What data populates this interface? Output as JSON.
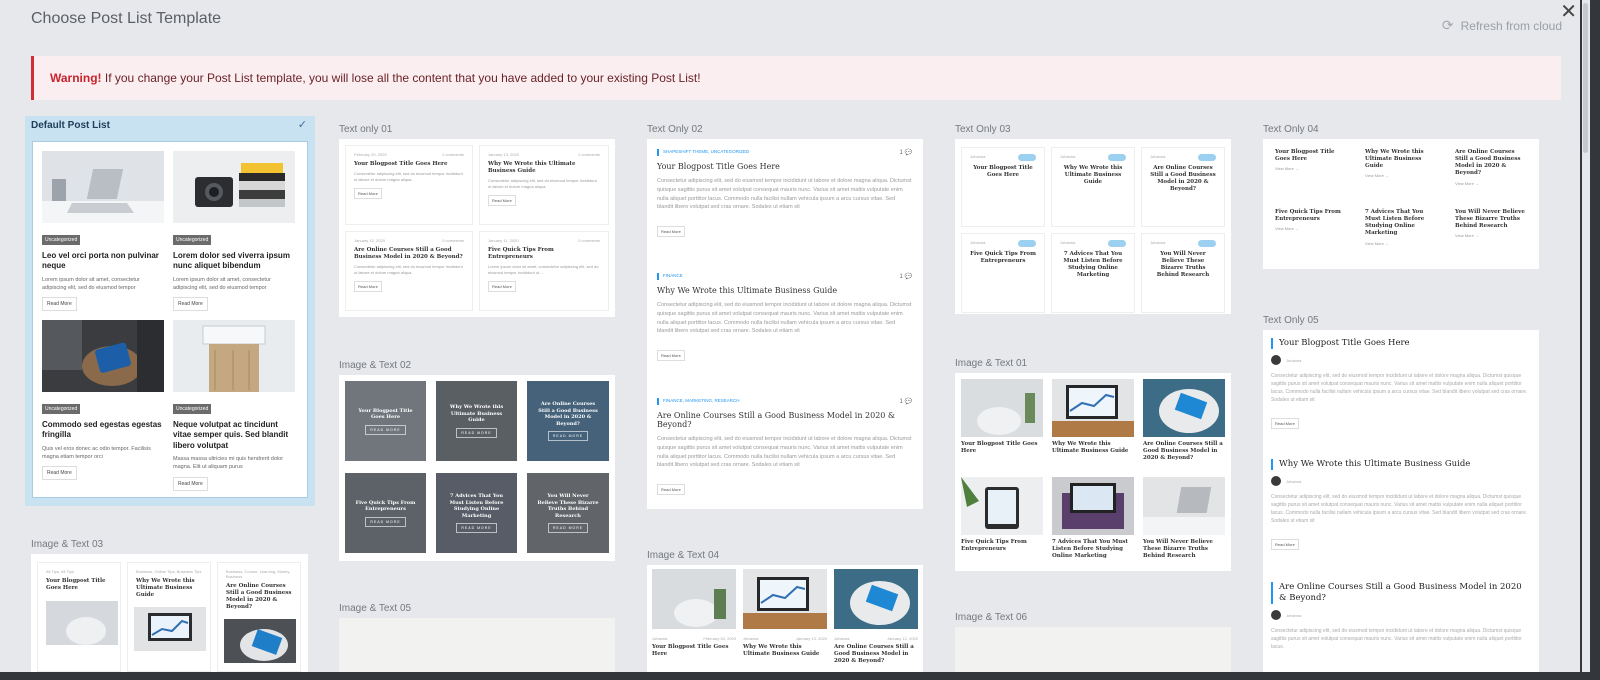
{
  "modal": {
    "title": "Choose Post List Template",
    "refresh_label": "Refresh from cloud",
    "close_glyph": "✕"
  },
  "warning": {
    "strong": "Warning!",
    "text": " If you change your Post List template, you will lose all the content that you have added to your existing Post List!"
  },
  "colors": {
    "warning_bg": "#fbeef0",
    "warning_accent": "#d12d36",
    "selected_bg": "#c8e2f2",
    "accent_blue": "#2196f3"
  },
  "templates": {
    "default": {
      "label": "Default Post List",
      "selected": true,
      "check": "✓",
      "posts": [
        {
          "badge": "Uncategorized",
          "title": "Leo vel orci porta non pulvinar neque",
          "text": "Lorem ipsum dolor sit amet, consectetur adipiscing elit, sed do eiusmod tempor",
          "more": "Read More"
        },
        {
          "badge": "Uncategorized",
          "title": "Lorem dolor sed viverra ipsum nunc aliquet bibendum",
          "text": "Lorem ipsum dolor sit amet, consectetur adipiscing elit, sed do eiusmod tempor",
          "more": "Read More"
        },
        {
          "badge": "Uncategorized",
          "title": "Commodo sed egestas egestas fringilla",
          "text": "Quis vel eros donec ac odio tempor. Facilisis magna etiam tempor orci",
          "more": "Read More"
        },
        {
          "badge": "Uncategorized",
          "title": "Neque volutpat ac tincidunt vitae semper quis. Sed blandit libero volutpat",
          "text": "Massa massa ultricies mi quis hendrerit dolor magna. Elit ut aliquam purus",
          "more": "Read More"
        }
      ]
    },
    "image_text_03": {
      "label": "Image & Text 03",
      "posts": [
        {
          "meta": "All Tips, All Tips",
          "title": "Your Blogpost Title Goes Here"
        },
        {
          "meta": "Business, Online Tips, Business Tips",
          "title": "Why We Wrote this Ultimate Business Guide"
        },
        {
          "meta": "Business, Course, Learning, Money, Business",
          "title": "Are Online Courses Still a Good Business Model in 2020 & Beyond?"
        }
      ]
    },
    "text_only_01": {
      "label": "Text only 01",
      "posts": [
        {
          "date": "February 20, 2020",
          "comments": "2 comments",
          "title": "Your Blogpost Title Goes Here",
          "text": "Consectetur adipiscing elit, sed do eiusmod tempor incididunt ut labore et dolore magna aliqua.",
          "more": "Read More"
        },
        {
          "date": "January 13, 2020",
          "comments": "2 comments",
          "title": "Why We Wrote this Ultimate Business Guide",
          "text": "Consectetur adipiscing elit, sed do eiusmod tempor incididunt ut labore et dolore magna aliqua.",
          "more": "Read More"
        },
        {
          "date": "January 12, 2020",
          "comments": "0 comments",
          "title": "Are Online Courses Still a Good Business Model in 2020 & Beyond?",
          "text": "Consectetur adipiscing elit, sed do eiusmod tempor incididunt ut labore et dolore magna aliqua.",
          "more": "Read More"
        },
        {
          "date": "January 11, 2020",
          "comments": "0 comments",
          "title": "Five Quick Tips From Entrepreneurs",
          "text": "Lorem ipsum dolor sit amet, consectetur adipiscing elit, sed do eiusmod tempor incididunt ut ...",
          "more": "Read More"
        }
      ]
    },
    "image_text_02": {
      "label": "Image & Text 02",
      "tiles": [
        {
          "title": "Your Blogpost Title Goes Here",
          "more": "READ MORE"
        },
        {
          "title": "Why We Wrote this Ultimate Business Guide",
          "more": "READ MORE"
        },
        {
          "title": "Are Online Courses Still a Good Business Model in 2020 & Beyond?",
          "more": "READ MORE"
        },
        {
          "title": "Five Quick Tips From Entrepreneurs",
          "more": "READ MORE"
        },
        {
          "title": "7 Advices That You Must Listen Before Studying Online Marketing",
          "more": "READ MORE"
        },
        {
          "title": "You Will Never Believe These Bizarre Truths Behind Research",
          "more": "READ MORE"
        }
      ]
    },
    "image_text_05": {
      "label": "Image & Text 05"
    },
    "text_only_02": {
      "label": "Text Only 02",
      "posts": [
        {
          "cat": "SHAPESHIFT THEME, UNCATEGORIZED",
          "count": "1",
          "title": "Your Blogpost Title Goes Here",
          "text": "Consectetur adipiscing elit, sed do eiusmod tempor incididunt ut labore et dolore magna aliqua. Dictumst quisque sagittis purus sit amet volutpat consequat mauris nunc. Varius sit amet mattis vulputate enim nulla aliquet porttitor lacus. Commodo nulla facilisi nullam vehicula ipsum a arcu cursus vitae. Sed blandit libero volutpat sed cras ornare. Sodales ut etiam sit",
          "more": "Read More"
        },
        {
          "cat": "FINANCE",
          "count": "1",
          "title": "Why We Wrote this Ultimate Business Guide",
          "text": "Consectetur adipiscing elit, sed do eiusmod tempor incididunt ut labore et dolore magna aliqua. Dictumst quisque sagittis purus sit amet volutpat consequat mauris nunc. Varius sit amet mattis vulputate enim nulla aliquet porttitor lacus. Commodo nulla facilisi nullam vehicula ipsum a arcu cursus vitae. Sed blandit libero volutpat sed cras ornare. Sodales ut etiam sit",
          "more": "Read More"
        },
        {
          "cat": "FINANCE, MARKETING, RESEARCH",
          "count": "1",
          "title": "Are Online Courses Still a Good Business Model in 2020 & Beyond?",
          "text": "Consectetur adipiscing elit, sed do eiusmod tempor incididunt ut labore et dolore magna aliqua. Dictumst quisque sagittis purus sit amet volutpat consequat mauris nunc. Varius sit amet mattis vulputate enim nulla aliquet porttitor lacus. Commodo nulla facilisi nullam vehicula ipsum a arcu cursus vitae. Sed blandit libero volutpat sed cras ornare. Sodales ut etiam sit",
          "more": "Read More"
        }
      ]
    },
    "image_text_04": {
      "label": "Image & Text 04",
      "posts": [
        {
          "author": "Johanna",
          "date": "February 20, 2020",
          "title": "Your Blogpost Title Goes Here"
        },
        {
          "author": "Johanna",
          "date": "January 13, 2020",
          "title": "Why We Wrote this Ultimate Business Guide"
        },
        {
          "author": "Johanna",
          "date": "January 12, 2020",
          "title": "Are Online Courses Still a Good Business Model in 2020 & Beyond?"
        }
      ]
    },
    "text_only_03": {
      "label": "Text Only 03",
      "posts": [
        {
          "author": "Johanna",
          "title": "Your Blogpost Title Goes Here"
        },
        {
          "author": "Johanna",
          "title": "Why We Wrote this Ultimate Business Guide"
        },
        {
          "author": "Johanna",
          "title": "Are Online Courses Still a Good Business Model in 2020 & Beyond?"
        },
        {
          "author": "Johanna",
          "title": "Five Quick Tips From Entrepreneurs"
        },
        {
          "author": "Johanna",
          "title": "7 Advices That You Must Listen Before Studying Online Marketing"
        },
        {
          "author": "Johanna",
          "title": "You Will Never Believe These Bizarre Truths Behind Research"
        }
      ]
    },
    "image_text_01": {
      "label": "Image & Text 01",
      "posts": [
        {
          "title": "Your Blogpost Title Goes Here"
        },
        {
          "title": "Why We Wrote this Ultimate Business Guide"
        },
        {
          "title": "Are Online Courses Still a Good Business Model in 2020 & Beyond?"
        },
        {
          "title": "Five Quick Tips From Entrepreneurs"
        },
        {
          "title": "7 Advices That You Must Listen Before Studying Online Marketing"
        },
        {
          "title": "You Will Never Believe These Bizarre Truths Behind Research"
        }
      ]
    },
    "image_text_06": {
      "label": "Image & Text 06"
    },
    "text_only_04": {
      "label": "Text Only 04",
      "posts": [
        {
          "title": "Your Blogpost Title Goes Here",
          "more": "View More →"
        },
        {
          "title": "Why We Wrote this Ultimate Business Guide",
          "more": "View More →"
        },
        {
          "title": "Are Online Courses Still a Good Business Model in 2020 & Beyond?",
          "more": "View More →"
        },
        {
          "title": "Five Quick Tips From Entrepreneurs",
          "more": "View More →"
        },
        {
          "title": "7 Advices That You Must Listen Before Studying Online Marketing",
          "more": "View More →"
        },
        {
          "title": "You Will Never Believe These Bizarre Truths Behind Research",
          "more": "View More →"
        }
      ]
    },
    "text_only_05": {
      "label": "Text Only 05",
      "posts": [
        {
          "title": "Your Blogpost Title Goes Here",
          "author": "Johanna",
          "text": "Consectetur adipiscing elit, sed do eiusmod tempor incididunt ut labore et dolore magna aliqua. Dictumst quisque sagittis purus sit amet volutpat consequat mauris nunc. Varius sit amet mattis vulputate enim nulla aliquet porttitor lacus. Commodo nulla facilisi nullam vehicula ipsum a arcu cursus vitae. Sed blandit libero volutpat sed cras ornare. Sodales ut etiam sit",
          "more": "Read More"
        },
        {
          "title": "Why We Wrote this Ultimate Business Guide",
          "author": "Johanna",
          "text": "Consectetur adipiscing elit, sed do eiusmod tempor incididunt ut labore et dolore magna aliqua. Dictumst quisque sagittis purus sit amet volutpat consequat mauris nunc. Varius sit amet mattis vulputate enim nulla aliquet porttitor lacus. Commodo nulla facilisi nullam vehicula ipsum a arcu cursus vitae. Sed blandit libero volutpat sed cras ornare. Sodales ut etiam sit",
          "more": "Read More"
        },
        {
          "title": "Are Online Courses Still a Good Business Model in 2020 & Beyond?",
          "author": "Johanna",
          "text": "Consectetur adipiscing elit, sed do eiusmod tempor incididunt ut labore et dolore magna aliqua. Dictumst quisque sagittis purus sit amet volutpat consequat mauris nunc. Varius sit amet mattis vulputate enim nulla aliquet porttitor lacus."
        }
      ]
    }
  }
}
